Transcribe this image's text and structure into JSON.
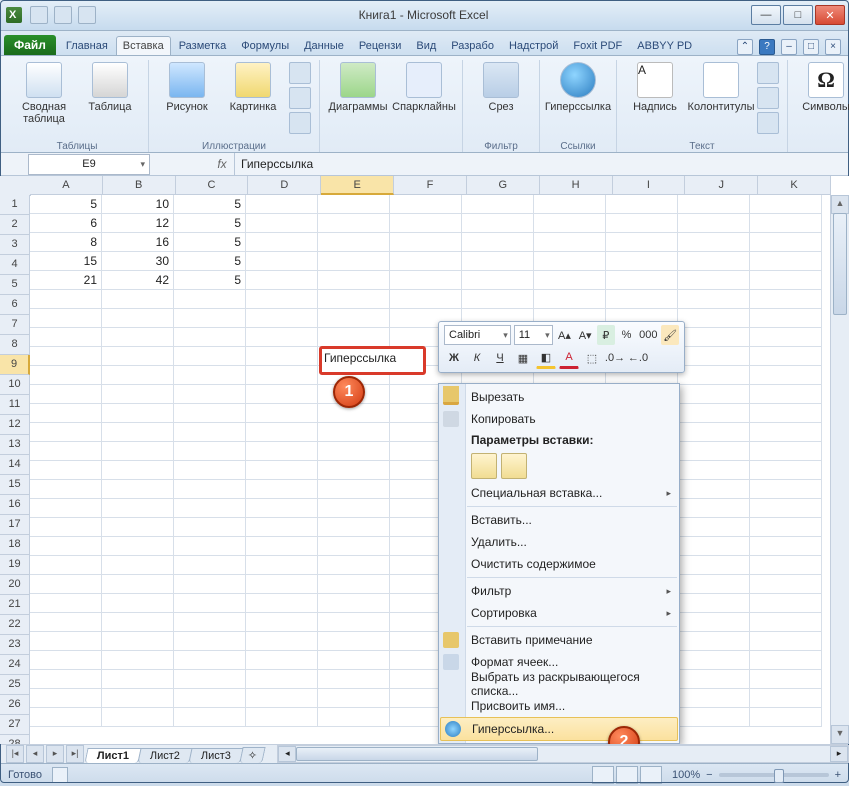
{
  "window": {
    "title": "Книга1  -  Microsoft Excel"
  },
  "tabs": {
    "file": "Файл",
    "items": [
      "Главная",
      "Вставка",
      "Разметка",
      "Формулы",
      "Данные",
      "Рецензи",
      "Вид",
      "Разрабо",
      "Надстрой",
      "Foxit PDF",
      "ABBYY PD"
    ],
    "active_index": 1
  },
  "ribbon": {
    "groups": {
      "tables": {
        "label": "Таблицы",
        "pivot": "Сводная таблица",
        "table": "Таблица"
      },
      "illustrations": {
        "label": "Иллюстрации",
        "picture": "Рисунок",
        "clipart": "Картинка"
      },
      "charts": {
        "label": "",
        "charts": "Диаграммы",
        "sparklines": "Спарклайны"
      },
      "filter": {
        "label": "Фильтр",
        "slicer": "Срез"
      },
      "links": {
        "label": "Ссылки",
        "hyperlink": "Гиперссылка"
      },
      "text": {
        "label": "Текст",
        "textbox": "Надпись",
        "headerfooter": "Колонтитулы"
      },
      "symbols": {
        "label": "",
        "symbols": "Символы"
      }
    }
  },
  "formula_bar": {
    "name_box": "E9",
    "fx_label": "fx",
    "value": "Гиперссылка"
  },
  "grid": {
    "columns": [
      "A",
      "B",
      "C",
      "D",
      "E",
      "F",
      "G",
      "H",
      "I",
      "J",
      "K"
    ],
    "selected_col_index": 4,
    "selected_row_index": 8,
    "row_count": 28,
    "data": [
      {
        "A": "5",
        "B": "10",
        "C": "5"
      },
      {
        "A": "6",
        "B": "12",
        "C": "5"
      },
      {
        "A": "8",
        "B": "16",
        "C": "5"
      },
      {
        "A": "15",
        "B": "30",
        "C": "5"
      },
      {
        "A": "21",
        "B": "42",
        "C": "5"
      }
    ],
    "selected_cell_text": "Гиперссылка"
  },
  "mini_toolbar": {
    "font": "Calibri",
    "size": "11",
    "bold": "Ж",
    "italic": "К",
    "underline": "Ч"
  },
  "context_menu": {
    "cut": "Вырезать",
    "copy": "Копировать",
    "paste_options_header": "Параметры вставки:",
    "paste_special": "Специальная вставка...",
    "insert": "Вставить...",
    "delete": "Удалить...",
    "clear": "Очистить содержимое",
    "filter": "Фильтр",
    "sort": "Сортировка",
    "comment": "Вставить примечание",
    "format": "Формат ячеек...",
    "pick": "Выбрать из раскрывающегося списка...",
    "name": "Присвоить имя...",
    "hyperlink": "Гиперссылка..."
  },
  "callouts": {
    "one": "1",
    "two": "2"
  },
  "sheets": {
    "items": [
      "Лист1",
      "Лист2",
      "Лист3"
    ],
    "active_index": 0
  },
  "status_bar": {
    "ready": "Готово",
    "zoom_minus": "−",
    "zoom_plus": "+",
    "zoom_pct": "100%"
  }
}
